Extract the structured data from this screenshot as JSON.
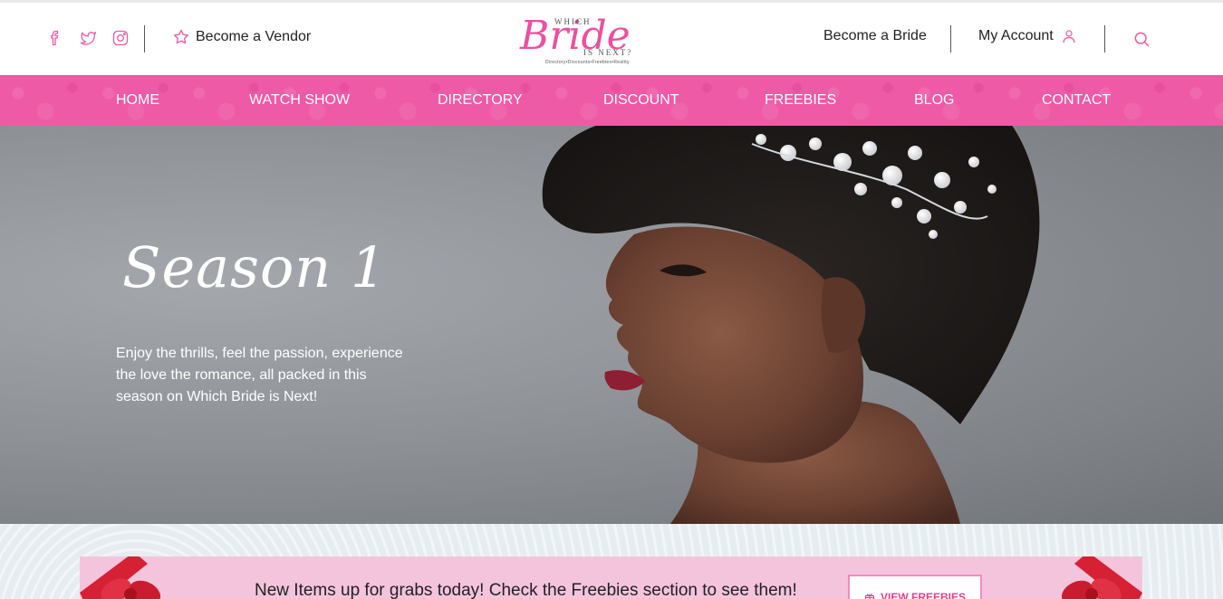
{
  "header": {
    "social_icons": [
      "facebook-icon",
      "twitter-icon",
      "instagram-icon"
    ],
    "vendor_label": "Become a Vendor",
    "logo": {
      "which": "WHICH",
      "bride": "Bride",
      "is_next": "IS NEXT?",
      "tagline": "Directory•Discounts•Freebies•Reality"
    },
    "bride_label": "Become a Bride",
    "account_label": "My Account"
  },
  "nav": {
    "items": [
      "HOME",
      "WATCH SHOW",
      "DIRECTORY",
      "DISCOUNT",
      "FREEBIES",
      "BLOG",
      "CONTACT"
    ]
  },
  "hero": {
    "title": "Season 1",
    "description": "Enjoy the thrills, feel the passion, experience the love the romance, all packed in this season on Which Bride is Next!"
  },
  "banner": {
    "text": "New Items up for grabs today! Check the Freebies section to see them!",
    "button_label": "VIEW FREEBIES"
  },
  "colors": {
    "accent": "#ee5aa6",
    "banner_bg": "#f4c4dc",
    "hero_bg": "#8f9398"
  }
}
